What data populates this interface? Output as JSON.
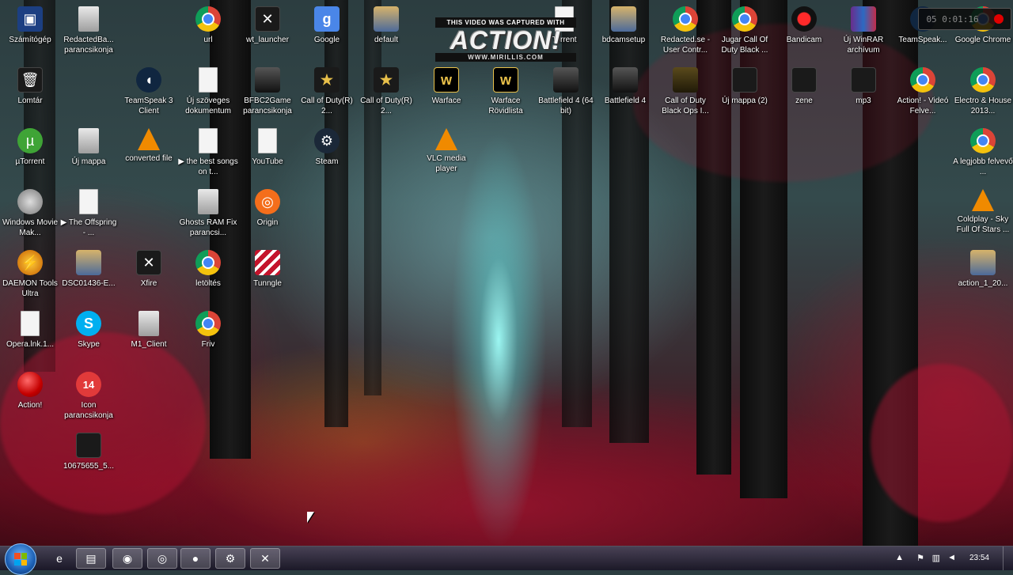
{
  "desktop_icons": [
    {
      "label": "Számítógép",
      "icon": "computer-icon",
      "glyph": "g-blue",
      "sym": "▣"
    },
    {
      "label": "RedactedBa... parancsikonja",
      "icon": "game-icon",
      "glyph": "g-folder",
      "sym": ""
    },
    {
      "label": "url",
      "icon": "chrome-icon",
      "glyph": "g-chrome",
      "sym": ""
    },
    {
      "label": "wt_launcher",
      "icon": "launcher-icon",
      "glyph": "g-dark",
      "sym": "✕"
    },
    {
      "label": "Google",
      "icon": "google-icon",
      "glyph": "g-google",
      "sym": "g"
    },
    {
      "label": "default",
      "icon": "default-icon",
      "glyph": "g-pic",
      "sym": ""
    },
    {
      "label": "Torrent",
      "icon": "torrent-icon",
      "glyph": "g-file",
      "sym": ""
    },
    {
      "label": "bdcamsetup",
      "icon": "installer-icon",
      "glyph": "g-pic",
      "sym": ""
    },
    {
      "label": "Redacted.se - User Contr...",
      "icon": "chrome-icon",
      "glyph": "g-chrome",
      "sym": ""
    },
    {
      "label": "Jugar Call Of Duty Black ...",
      "icon": "chrome-icon",
      "glyph": "g-chrome",
      "sym": ""
    },
    {
      "label": "Bandicam",
      "icon": "bandicam-icon",
      "glyph": "g-bandi",
      "sym": ""
    },
    {
      "label": "Új WinRAR archívum",
      "icon": "winrar-icon",
      "glyph": "g-rar",
      "sym": ""
    },
    {
      "label": "TeamSpeak...",
      "icon": "teamspeak-icon",
      "glyph": "g-ts",
      "sym": ""
    },
    {
      "label": "Google Chrome",
      "icon": "chrome-icon",
      "glyph": "g-chrome",
      "sym": ""
    },
    {
      "label": "Lomtár",
      "icon": "recycle-bin-icon",
      "glyph": "g-dark",
      "sym": "🗑"
    },
    {
      "label": "TeamSpeak 3 Client",
      "icon": "teamspeak-icon",
      "glyph": "g-ts",
      "sym": "◖"
    },
    {
      "label": "Új szöveges dokumentum",
      "icon": "text-file-icon",
      "glyph": "g-file",
      "sym": ""
    },
    {
      "label": "BFBC2Game parancsikonja",
      "icon": "battlefield-icon",
      "glyph": "g-bf",
      "sym": ""
    },
    {
      "label": "Call of Duty(R) 2...",
      "icon": "cod2-icon",
      "glyph": "g-gold",
      "sym": "★"
    },
    {
      "label": "Call of Duty(R) 2...",
      "icon": "cod2-icon",
      "glyph": "g-gold",
      "sym": "★"
    },
    {
      "label": "Warface",
      "icon": "warface-icon",
      "glyph": "g-wf",
      "sym": "w"
    },
    {
      "label": "Warface Rövidlista",
      "icon": "warface-icon",
      "glyph": "g-wf",
      "sym": "w"
    },
    {
      "label": "Battlefield 4 (64 bit)",
      "icon": "battlefield-icon",
      "glyph": "g-bf",
      "sym": ""
    },
    {
      "label": "Battlefield 4",
      "icon": "battlefield-icon",
      "glyph": "g-bf",
      "sym": ""
    },
    {
      "label": "Call of Duty Black Ops I...",
      "icon": "cod-icon",
      "glyph": "g-cod",
      "sym": ""
    },
    {
      "label": "Új mappa (2)",
      "icon": "folder-icon",
      "glyph": "g-dark",
      "sym": ""
    },
    {
      "label": "zene",
      "icon": "folder-icon",
      "glyph": "g-dark",
      "sym": ""
    },
    {
      "label": "mp3",
      "icon": "folder-icon",
      "glyph": "g-dark",
      "sym": ""
    },
    {
      "label": "Action! - Videó Felve...",
      "icon": "chrome-icon",
      "glyph": "g-chrome",
      "sym": ""
    },
    {
      "label": "Electro & House 2013...",
      "icon": "chrome-icon",
      "glyph": "g-chrome",
      "sym": ""
    },
    {
      "label": "µTorrent",
      "icon": "utorrent-icon",
      "glyph": "g-green",
      "sym": "µ"
    },
    {
      "label": "Új mappa",
      "icon": "folder-icon",
      "glyph": "g-folder",
      "sym": ""
    },
    {
      "label": "converted file",
      "icon": "vlc-icon",
      "glyph": "g-vlc",
      "sym": ""
    },
    {
      "label": "▶ the best songs on t...",
      "icon": "text-file-icon",
      "glyph": "g-file",
      "sym": ""
    },
    {
      "label": "YouTube",
      "icon": "text-file-icon",
      "glyph": "g-file",
      "sym": ""
    },
    {
      "label": "Steam",
      "icon": "steam-icon",
      "glyph": "g-steam",
      "sym": "⚙"
    },
    {
      "label": "VLC media player",
      "icon": "vlc-icon",
      "glyph": "g-vlc",
      "sym": ""
    },
    {
      "label": "A legjobb felvevő ...",
      "icon": "chrome-icon",
      "glyph": "g-chrome",
      "sym": ""
    },
    {
      "label": "Windows Movie Mak...",
      "icon": "movie-maker-icon",
      "glyph": "g-movie",
      "sym": ""
    },
    {
      "label": "▶ The Offspring - ...",
      "icon": "text-file-icon",
      "glyph": "g-file",
      "sym": ""
    },
    {
      "label": "Ghosts RAM Fix parancsi...",
      "icon": "app-icon",
      "glyph": "g-folder",
      "sym": ""
    },
    {
      "label": "Origin",
      "icon": "origin-icon",
      "glyph": "g-orange",
      "sym": "◎"
    },
    {
      "label": "Coldplay - Sky Full Of Stars ...",
      "icon": "vlc-icon",
      "glyph": "g-vlc",
      "sym": ""
    },
    {
      "label": "DAEMON Tools Ultra",
      "icon": "daemon-tools-icon",
      "glyph": "g-daemon",
      "sym": "⚡"
    },
    {
      "label": "DSC01436-E...",
      "icon": "image-icon",
      "glyph": "g-pic",
      "sym": ""
    },
    {
      "label": "Xfire",
      "icon": "xfire-icon",
      "glyph": "g-dark",
      "sym": "✕"
    },
    {
      "label": "letöltés",
      "icon": "chrome-icon",
      "glyph": "g-chrome",
      "sym": ""
    },
    {
      "label": "Tunngle",
      "icon": "tunngle-icon",
      "glyph": "g-tunngle",
      "sym": ""
    },
    {
      "label": "action_1_20...",
      "icon": "archive-icon",
      "glyph": "g-pic",
      "sym": ""
    },
    {
      "label": "Opera.lnk.1...",
      "icon": "text-file-icon",
      "glyph": "g-file",
      "sym": ""
    },
    {
      "label": "Skype",
      "icon": "skype-icon",
      "glyph": "g-skype",
      "sym": "S"
    },
    {
      "label": "M1_Client",
      "icon": "folder-icon",
      "glyph": "g-folder",
      "sym": ""
    },
    {
      "label": "Friv",
      "icon": "chrome-icon",
      "glyph": "g-chrome",
      "sym": ""
    },
    {
      "label": "Action!",
      "icon": "action-icon",
      "glyph": "g-red",
      "sym": ""
    },
    {
      "label": "Icon parancsikonja",
      "icon": "app-icon",
      "glyph": "g-14",
      "sym": "14"
    },
    {
      "label": "10675655_5...",
      "icon": "image-icon",
      "glyph": "g-dark",
      "sym": ""
    }
  ],
  "watermark": {
    "line1": "THIS VIDEO WAS CAPTURED WITH",
    "brand": "ACTION!",
    "url": "WWW.MIRILLIS.COM"
  },
  "recording": {
    "timer": "05 0:01:16"
  },
  "taskbar": {
    "clock": "23:54",
    "items": [
      {
        "name": "ie-icon",
        "sym": "e"
      },
      {
        "name": "explorer-icon",
        "sym": "▤"
      },
      {
        "name": "chrome-icon",
        "sym": "◉"
      },
      {
        "name": "origin-icon",
        "sym": "◎"
      },
      {
        "name": "action-icon",
        "sym": "●"
      },
      {
        "name": "steam-icon",
        "sym": "⚙"
      },
      {
        "name": "wt-launcher-icon",
        "sym": "✕"
      }
    ]
  }
}
